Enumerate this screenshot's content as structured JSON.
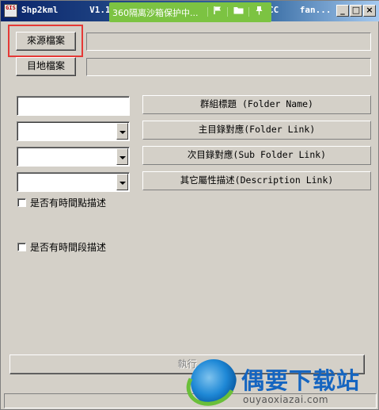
{
  "window": {
    "title_left": "Shp2kml      V1.1",
    "title_tail": "CC    fan...",
    "icon_text": "GIS",
    "minimize": "_",
    "maximize": "□",
    "close": "×"
  },
  "sandbox_bar": {
    "text": "360隔离沙箱保护中...",
    "icons": [
      "flag-icon",
      "folder-icon",
      "pin-icon"
    ],
    "color": "#7cc342"
  },
  "buttons": {
    "source_file": "來源檔案",
    "target_file": "目地檔案",
    "folder_name": "群組標題 (Folder Name)",
    "main_folder_link": "主目錄對應(Folder  Link)",
    "sub_folder_link": "次目錄對應(Sub Folder Link)",
    "description_link": "其它屬性描述(Description Link)",
    "execute": "執行"
  },
  "checkboxes": {
    "time_point": "是否有時間點描述",
    "time_span": "是否有時間段描述"
  },
  "watermark": {
    "title": "偶要下载站",
    "url": "ouyaoxiazai.com"
  },
  "colors": {
    "highlight": "#e53935",
    "face": "#d4d0c8",
    "titlebar": "#0a246a"
  }
}
